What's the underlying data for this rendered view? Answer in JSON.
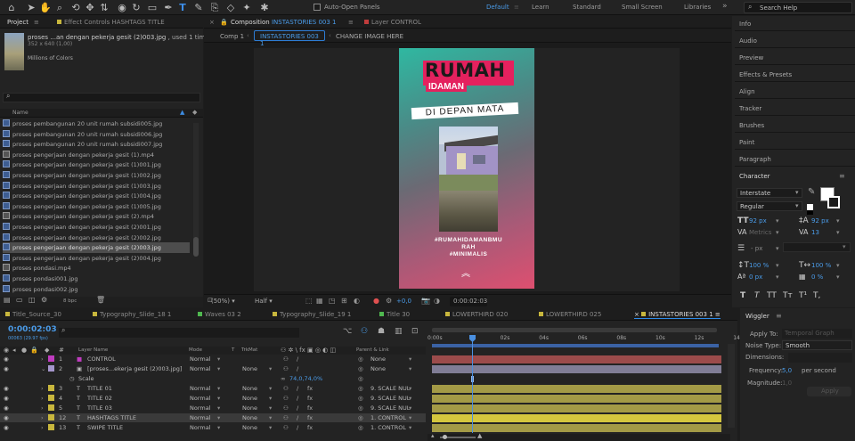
{
  "toolbar": {
    "auto_open_panels": "Auto-Open Panels",
    "workspaces": [
      "Default",
      "Learn",
      "Standard",
      "Small Screen",
      "Libraries"
    ],
    "search_placeholder": "Search Help"
  },
  "project_panel": {
    "tab": "Project",
    "effect_controls_tab": "Effect Controls HASHTAGS TITLE",
    "selected_name": "proses ...an dengan pekerja gesit (2)003.jpg",
    "used": ", used 1 time",
    "dims": "352 x 640 (1,00)",
    "colors": "Millions of Colors",
    "search_placeholder": "",
    "col_name": "Name",
    "files": [
      {
        "name": "proses pembangunan 20 unit rumah subsidi005.jpg",
        "type": "img"
      },
      {
        "name": "proses pembangunan 20 unit rumah subsidi006.jpg",
        "type": "img"
      },
      {
        "name": "proses pembangunan 20 unit rumah subsidi007.jpg",
        "type": "img"
      },
      {
        "name": "proses pengerjaan dengan pekerja gesit (1).mp4",
        "type": "vid"
      },
      {
        "name": "proses pengerjaan dengan pekerja gesit (1)001.jpg",
        "type": "img"
      },
      {
        "name": "proses pengerjaan dengan pekerja gesit (1)002.jpg",
        "type": "img"
      },
      {
        "name": "proses pengerjaan dengan pekerja gesit (1)003.jpg",
        "type": "img"
      },
      {
        "name": "proses pengerjaan dengan pekerja gesit (1)004.jpg",
        "type": "img"
      },
      {
        "name": "proses pengerjaan dengan pekerja gesit (1)005.jpg",
        "type": "img"
      },
      {
        "name": "proses pengerjaan dengan pekerja gesit (2).mp4",
        "type": "vid"
      },
      {
        "name": "proses pengerjaan dengan pekerja gesit (2)001.jpg",
        "type": "img"
      },
      {
        "name": "proses pengerjaan dengan pekerja gesit (2)002.jpg",
        "type": "img"
      },
      {
        "name": "proses pengerjaan dengan pekerja gesit (2)003.jpg",
        "type": "img",
        "selected": true
      },
      {
        "name": "proses pengerjaan dengan pekerja gesit (2)004.jpg",
        "type": "img"
      },
      {
        "name": "proses pondasi.mp4",
        "type": "vid"
      },
      {
        "name": "proses pondasi001.jpg",
        "type": "img"
      },
      {
        "name": "proses pondasi002.jpg",
        "type": "img"
      }
    ],
    "bpc": "8 bpc"
  },
  "composition": {
    "tab_label": "Composition",
    "tab_name": "INSTASTORIES 003 1",
    "layer_tab": "Layer  CONTROL",
    "breadcrumbs": [
      "Comp 1",
      "INSTASTORIES 003 1",
      "CHANGE IMAGE HERE"
    ],
    "title_line1": "RUMAH",
    "title_line2": "IDAMAN",
    "title_line3": "DI DEPAN MATA",
    "hashtags": "#RUMAHIDAMANBMU\nRAH\n#MINIMALIS",
    "zoom": "(50%)",
    "resolution": "Half",
    "exposure": "+0,0",
    "timecode": "0:00:02:03"
  },
  "right_panels": [
    "Info",
    "Audio",
    "Preview",
    "Effects & Presets",
    "Align",
    "Tracker",
    "Brushes",
    "Paint",
    "Paragraph"
  ],
  "character": {
    "title": "Character",
    "font": "Interstate",
    "style": "Regular",
    "size": "92 px",
    "leading": "92 px",
    "kerning": "Metrics",
    "tracking": "13",
    "stroke": "- px",
    "vscale": "100 %",
    "hscale": "100 %",
    "baseline": "0 px",
    "tsume": "0 %",
    "buttons": [
      "T",
      "T",
      "TT",
      "Tт",
      "T¹",
      "T,"
    ]
  },
  "timeline": {
    "tabs": [
      {
        "name": "Title_Source_30",
        "color": "#c8b73d"
      },
      {
        "name": "Typography_Slide_18 1",
        "color": "#c8b73d"
      },
      {
        "name": "Waves 03 2",
        "color": "#4fb84f"
      },
      {
        "name": "Typography_Slide_19 1",
        "color": "#c8b73d"
      },
      {
        "name": "Title 30",
        "color": "#4fb84f"
      },
      {
        "name": "LOWERTHIRD 020",
        "color": "#c8b73d"
      },
      {
        "name": "LOWERTHIRD 025",
        "color": "#c8b73d"
      },
      {
        "name": "INSTASTORIES 003 1",
        "color": "#c8b73d",
        "active": true
      }
    ],
    "timecode": "0:00:02:03",
    "frames": "00063 (29.97 fps)",
    "col_layer_name": "Layer Name",
    "col_mode": "Mode",
    "col_t": "T",
    "col_trkmat": "TrkMat",
    "col_parent": "Parent & Link",
    "ruler": [
      "0:00s",
      "02s",
      "04s",
      "06s",
      "08s",
      "10s",
      "12s",
      "14s"
    ],
    "layers": [
      {
        "num": "1",
        "name": "CONTROL",
        "color": "#c03cc0",
        "mode": "Normal",
        "trk": "",
        "parent": "None",
        "bar": "#9b4b4b",
        "icon": "solid"
      },
      {
        "num": "2",
        "name": "[proses...ekerja gesit (2)003.jpg]",
        "color": "#a596cc",
        "mode": "Normal",
        "trk": "None",
        "parent": "None",
        "bar": "#807d96",
        "icon": "img",
        "open": true
      },
      {
        "num": "3",
        "name": "TITLE 01",
        "color": "#c8b73d",
        "mode": "Normal",
        "trk": "None",
        "parent": "9. SCALE NUL",
        "bar": "#a39a46",
        "icon": "T"
      },
      {
        "num": "4",
        "name": "TITLE 02",
        "color": "#c8b73d",
        "mode": "Normal",
        "trk": "None",
        "parent": "9. SCALE NUL",
        "bar": "#a39a46",
        "icon": "T"
      },
      {
        "num": "5",
        "name": "TITLE 03",
        "color": "#c8b73d",
        "mode": "Normal",
        "trk": "None",
        "parent": "9. SCALE NUL",
        "bar": "#a39a46",
        "icon": "T"
      },
      {
        "num": "12",
        "name": "HASHTAGS TITLE",
        "color": "#c8b73d",
        "mode": "Normal",
        "trk": "None",
        "parent": "1. CONTROL",
        "bar": "#d4c63e",
        "icon": "T",
        "selected": true
      },
      {
        "num": "13",
        "name": "SWIPE TITLE",
        "color": "#c8b73d",
        "mode": "Normal",
        "trk": "None",
        "parent": "1. CONTROL",
        "bar": "#a39a46",
        "icon": "T"
      }
    ],
    "scale_label": "Scale",
    "scale_value": "74,0,74,0%"
  },
  "wiggler": {
    "title": "Wiggler",
    "apply_to_label": "Apply To:",
    "apply_to_value": "Temporal Graph",
    "noise_label": "Noise Type:",
    "noise_value": "Smooth",
    "dimensions_label": "Dimensions:",
    "frequency_label": "Frequency:",
    "frequency_value": "5,0",
    "per_second": "per second",
    "magnitude_label": "Magnitude:",
    "magnitude_value": "1,0",
    "apply_button": "Apply"
  },
  "colors": {
    "accent": "#2d8ceb",
    "playhead": "#4a8fe0"
  }
}
